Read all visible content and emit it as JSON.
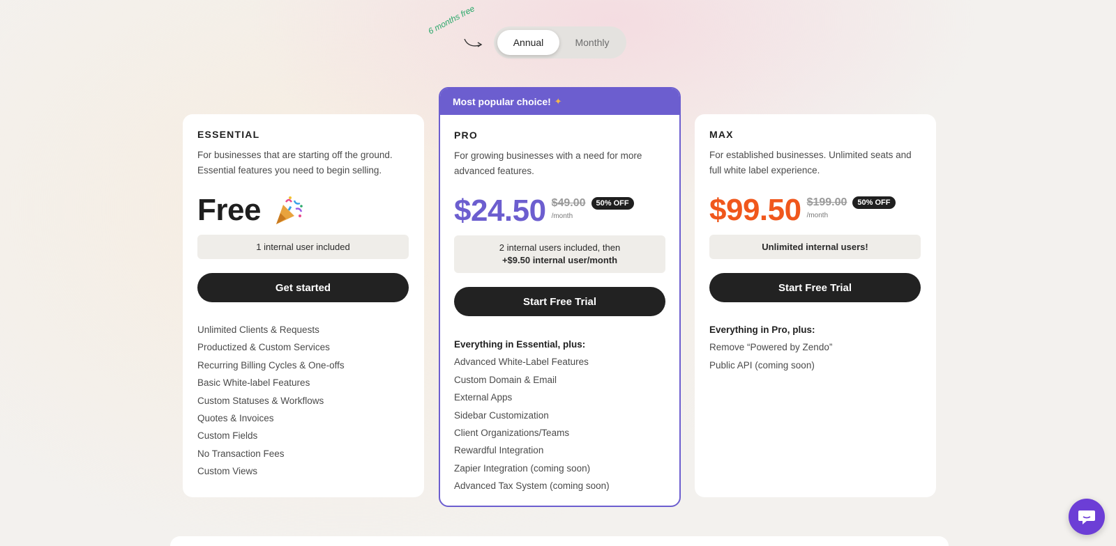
{
  "billing_toggle": {
    "promo_text": "6 months free",
    "annual_label": "Annual",
    "monthly_label": "Monthly",
    "selected": "Annual"
  },
  "plans": {
    "essential": {
      "name": "ESSENTIAL",
      "description": "For businesses that are starting off the ground. Essential features you need to begin selling.",
      "price": "Free",
      "price_icon": "party-popper-icon",
      "users_note": "1 internal user included",
      "cta": "Get started",
      "features": [
        "Unlimited Clients & Requests",
        "Productized & Custom Services",
        "Recurring Billing Cycles & One-offs",
        "Basic White-label Features",
        "Custom Statuses & Workflows",
        "Quotes & Invoices",
        "Custom Fields",
        "No Transaction Fees",
        "Custom Views"
      ]
    },
    "pro": {
      "banner": "Most popular choice!",
      "banner_icon": "sparkle-icon",
      "name": "PRO",
      "description": "For growing businesses with a need for more advanced features.",
      "price": "$24.50",
      "old_price": "$49.00",
      "discount_badge": "50% OFF",
      "per_period": "/month",
      "users_note_line1": "2 internal users included, then",
      "users_note_line2": "+$9.50 internal user/month",
      "cta": "Start Free Trial",
      "features_lead": "Everything in Essential, plus:",
      "features": [
        "Advanced White-Label Features",
        "Custom Domain & Email",
        "External Apps",
        "Sidebar Customization",
        "Client Organizations/Teams",
        "Rewardful Integration",
        "Zapier Integration (coming soon)",
        "Advanced Tax System (coming soon)"
      ]
    },
    "max": {
      "name": "MAX",
      "description": "For established businesses. Unlimited seats and full white label experience.",
      "price": "$99.50",
      "old_price": "$199.00",
      "discount_badge": "50% OFF",
      "per_period": "/month",
      "users_note": "Unlimited internal users!",
      "cta": "Start Free Trial",
      "features_lead": "Everything in Pro, plus:",
      "features": [
        "Remove “Powered by Zendo”",
        "Public API (coming soon)"
      ]
    }
  },
  "colors": {
    "accent_purple": "#6c5ecf",
    "accent_orange": "#f0571c",
    "dark_button": "#222222",
    "chat_button": "#6c3ed6",
    "promo_green": "#2aa86a"
  },
  "chat_widget": {
    "icon": "chat-bubble-icon"
  }
}
